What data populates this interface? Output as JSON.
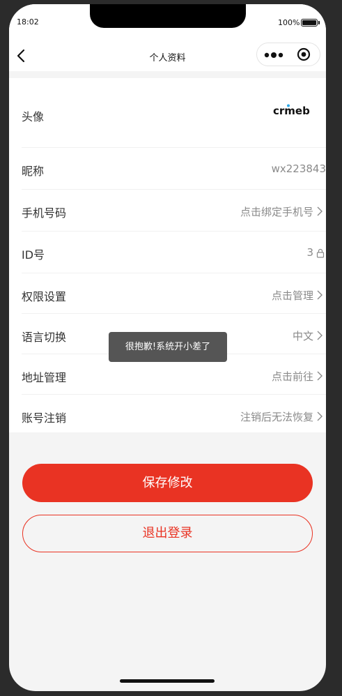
{
  "status_bar": {
    "time": "18:02",
    "battery_percent": "100%"
  },
  "nav": {
    "title": "个人资料"
  },
  "profile": {
    "avatar_label": "头像",
    "avatar_logo_text": "crmeb",
    "nickname_label": "昵称",
    "nickname_value": "wx223843",
    "phone_label": "手机号码",
    "phone_value": "点击绑定手机号",
    "id_label": "ID号",
    "id_value": "3",
    "permission_label": "权限设置",
    "permission_value": "点击管理",
    "language_label": "语言切换",
    "language_value": "中文",
    "address_label": "地址管理",
    "address_value": "点击前往",
    "account_label": "账号注销",
    "account_value": "注销后无法恢复"
  },
  "toast": {
    "message": "很抱歉!系统开小差了"
  },
  "actions": {
    "save_label": "保存修改",
    "logout_label": "退出登录"
  },
  "colors": {
    "accent": "#e93323",
    "toast_bg": "#555555",
    "logo_dot": "#2aa7e8"
  }
}
